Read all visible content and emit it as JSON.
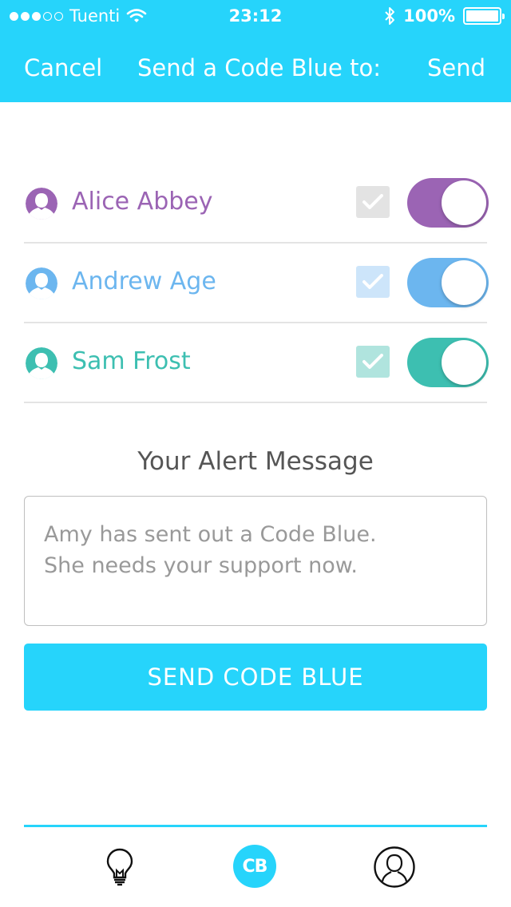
{
  "status": {
    "carrier": "Tuenti",
    "time": "23:12",
    "battery": "100%",
    "signal_bars_filled": 3,
    "signal_bars_total": 5
  },
  "nav": {
    "cancel": "Cancel",
    "title": "Send a Code Blue to:",
    "send": "Send"
  },
  "contacts": [
    {
      "name": "Alice Abbey",
      "color": "#9b64b4",
      "check_bg": "#e3e3e3",
      "selected": true,
      "toggle_on": true
    },
    {
      "name": "Andrew Age",
      "color": "#6cb6ef",
      "check_bg": "#cde5fa",
      "selected": true,
      "toggle_on": true
    },
    {
      "name": "Sam Frost",
      "color": "#3dbfb1",
      "check_bg": "#b0e4de",
      "selected": true,
      "toggle_on": true
    }
  ],
  "message": {
    "title": "Your Alert Message",
    "line1": "Amy has sent out a Code Blue.",
    "line2": "She needs your support now."
  },
  "send_button": "SEND CODE BLUE",
  "tabs": {
    "center_label": "CB",
    "active": "code-blue"
  },
  "colors": {
    "accent": "#26d4fb"
  }
}
